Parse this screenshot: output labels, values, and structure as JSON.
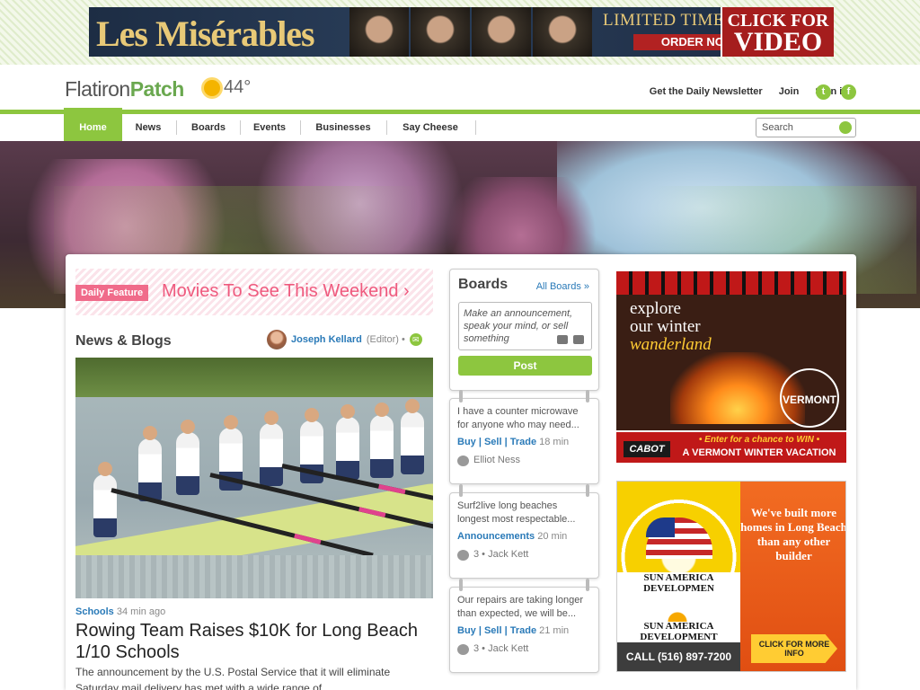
{
  "top_ad": {
    "title": "Les Misérables",
    "offer": "LIMITED TIME OFFERS",
    "order": "ORDER NOW",
    "click_line1": "CLICK FOR",
    "click_line2": "VIDEO"
  },
  "header": {
    "logo_prefix": "Flatiron",
    "logo_brand": "Patch",
    "temperature": "44°",
    "newsletter": "Get the Daily Newsletter",
    "join": "Join",
    "sign_in": "Sign in",
    "twitter": "t",
    "facebook": "f"
  },
  "nav": {
    "items": [
      "Home",
      "News",
      "Boards",
      "Events",
      "Businesses",
      "Say Cheese"
    ],
    "active": "Home",
    "search_placeholder": "Search"
  },
  "daily_feature": {
    "tag": "Daily Feature",
    "text": "Movies To See This Weekend ›"
  },
  "news": {
    "heading": "News & Blogs",
    "author": "Joseph Kellard",
    "role": "(Editor) •",
    "category": "Schools",
    "time": "34 min ago",
    "headline": "Rowing Team Raises $10K for Long Beach 1/10 Schools",
    "summary": "The announcement by the U.S. Postal Service that it will eliminate Saturday mail delivery has met with a wide range of"
  },
  "boards": {
    "heading": "Boards",
    "all_link": "All Boards »",
    "placeholder": "Make an announcement, speak your mind, or sell something",
    "post_button": "Post",
    "posts": [
      {
        "text": "I have a counter microwave for anyone who may need...",
        "category": "Buy | Sell | Trade",
        "time": "18 min",
        "user": "Elliot Ness"
      },
      {
        "text": "Surf2live long beaches longest most respectable...",
        "category": "Announcements",
        "time": "20 min",
        "user": "3 • Jack Kett"
      },
      {
        "text": "Our repairs are taking longer than expected, we will be...",
        "category": "Buy | Sell | Trade",
        "time": "21 min",
        "user": "3 • Jack Kett"
      }
    ]
  },
  "ad_vermont": {
    "line1": "explore",
    "line2": "our winter",
    "line3": "wanderland",
    "seal": "VERMONT",
    "brand": "CABOT",
    "enter": "• Enter for a chance to WIN •",
    "prize": "A VERMONT WINTER VACATION"
  },
  "ad_sunamerica": {
    "name1": "SUN AMERICA DEVELOPMEN",
    "name2": "SUN AMERICA DEVELOPMENT",
    "phone": "CALL (516) 897-7200",
    "message": "We've built more homes in Long Beach than any other builder",
    "cta": "CLICK FOR MORE INFO"
  }
}
